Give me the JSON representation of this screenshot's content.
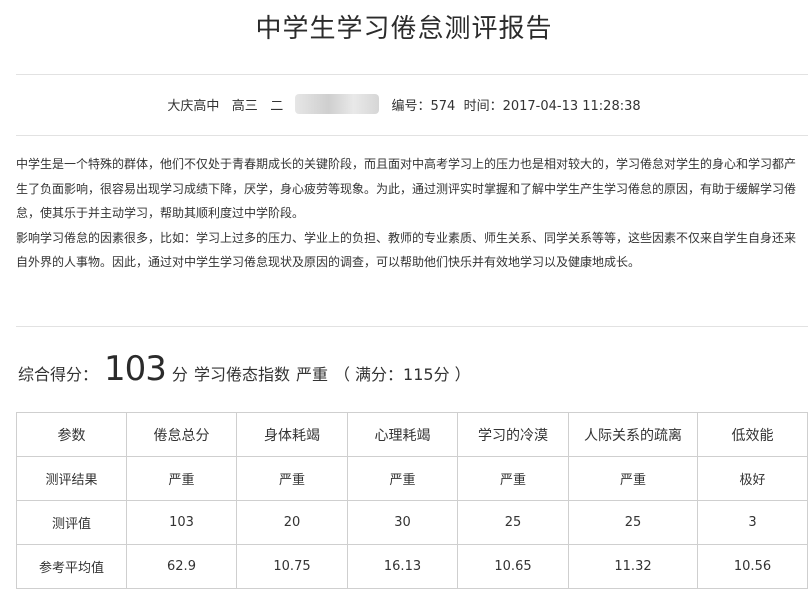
{
  "title": "中学生学习倦怠测评报告",
  "meta": {
    "school": "大庆高中",
    "grade": "高三",
    "class_no": "二",
    "id_label": "编号：574",
    "time_label": "时间：2017-04-13 11:28:38"
  },
  "intro": {
    "para1": "中学生是一个特殊的群体，他们不仅处于青春期成长的关键阶段，而且面对中高考学习上的压力也是相对较大的，学习倦怠对学生的身心和学习都产生了负面影响，很容易出现学习成绩下降，厌学，身心疲劳等现象。为此，通过测评实时掌握和了解中学生产生学习倦怠的原因，有助于缓解学习倦怠，使其乐于并主动学习，帮助其顺利度过中学阶段。",
    "para2": "影响学习倦怠的因素很多，比如：学习上过多的压力、学业上的负担、教师的专业素质、师生关系、同学关系等等，这些因素不仅来自学生自身还来自外界的人事物。因此，通过对中学生学习倦怠现状及原因的调查，可以帮助他们快乐并有效地学习以及健康地成长。"
  },
  "score": {
    "label": "综合得分：",
    "value": "103",
    "unit": "分",
    "index_label": "学习倦态指数",
    "index_value": "严重",
    "full_label": "（ 满分：115分 ）"
  },
  "table": {
    "headers": [
      "参数",
      "倦怠总分",
      "身体耗竭",
      "心理耗竭",
      "学习的冷漠",
      "人际关系的疏离",
      "低效能"
    ],
    "rows": [
      [
        "测评结果",
        "严重",
        "严重",
        "严重",
        "严重",
        "严重",
        "极好"
      ],
      [
        "测评值",
        "103",
        "20",
        "30",
        "25",
        "25",
        "3"
      ],
      [
        "参考平均值",
        "62.9",
        "10.75",
        "16.13",
        "10.65",
        "11.32",
        "10.56"
      ]
    ]
  }
}
